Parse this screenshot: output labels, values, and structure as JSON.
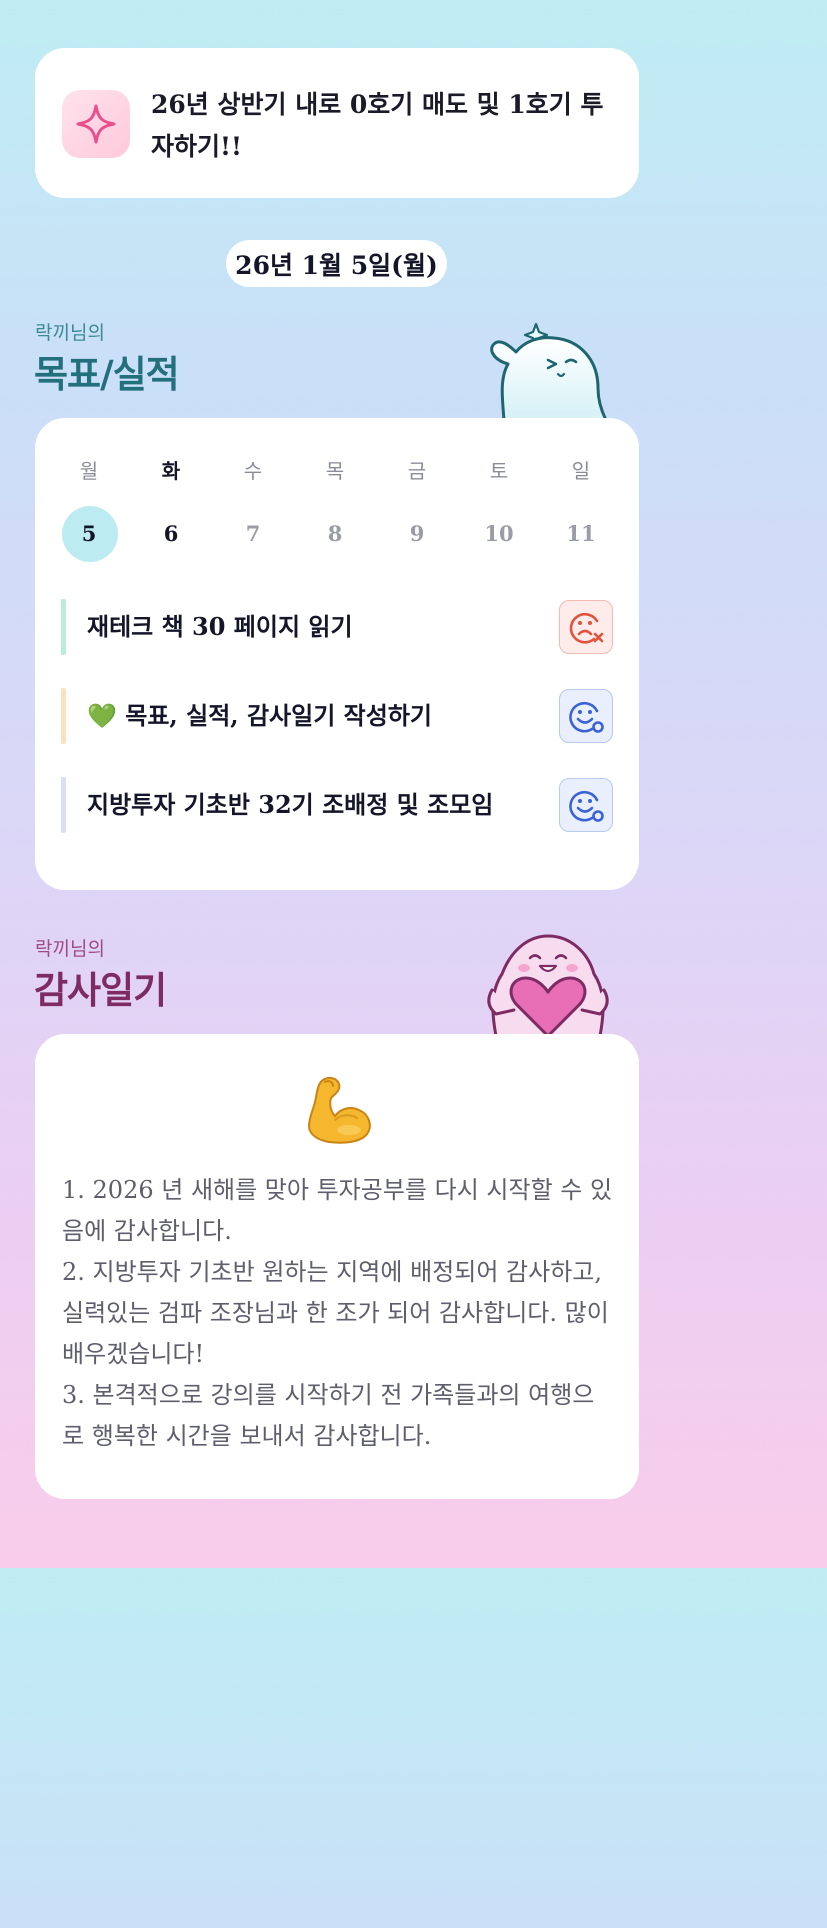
{
  "goal": {
    "icon": "sparkle-icon",
    "text": "26년 상반기 내로 0호기 매도 및 1호기 투자하기!!"
  },
  "date": "26년 1월 5일(월)",
  "goals_section": {
    "subtitle": "락끼님의",
    "title": "목표/실적",
    "mascot": "waving-ghost-mascot"
  },
  "calendar": {
    "weekdays": [
      "월",
      "화",
      "수",
      "목",
      "금",
      "토",
      "일"
    ],
    "days": [
      "5",
      "6",
      "7",
      "8",
      "9",
      "10",
      "11"
    ],
    "selected_index": 0,
    "emphasized_index": 1
  },
  "tasks": [
    {
      "label": "재테크 책 30 페이지 읽기",
      "bar_color": "#b9ecd9",
      "status": "not-done",
      "status_icon": "sad-face-x-icon"
    },
    {
      "label": "💚 목표, 실적, 감사일기 작성하기",
      "bar_color": "#fde0c2",
      "status": "done",
      "status_icon": "smile-face-check-icon"
    },
    {
      "label": "지방투자 기초반 32기 조배정 및 조모임",
      "bar_color": "#d6e0f7",
      "status": "done",
      "status_icon": "smile-face-check-icon"
    }
  ],
  "gratitude_section": {
    "subtitle": "락끼님의",
    "title": "감사일기",
    "mascot": "heart-hugging-ghost-mascot",
    "emoji": "flexed-biceps-emoji",
    "lines": [
      "1. 2026 년 새해를 맞아 투자공부를 다시 시작할 수 있음에 감사합니다.",
      "2. 지방투자 기초반 원하는 지역에 배정되어 감사하고, 실력있는 검파 조장님과 한 조가 되어 감사합니다. 많이 배우겠습니다!",
      "3. 본격적으로 강의를 시작하기 전 가족들과의 여행으로 행복한 시간을 보내서 감사합니다."
    ]
  },
  "colors": {
    "teal_title": "#23707d",
    "plum_title": "#7e2a63",
    "selected_day": "#bdebf2",
    "fail_red": "#e2533f",
    "ok_blue": "#3b63d6"
  }
}
